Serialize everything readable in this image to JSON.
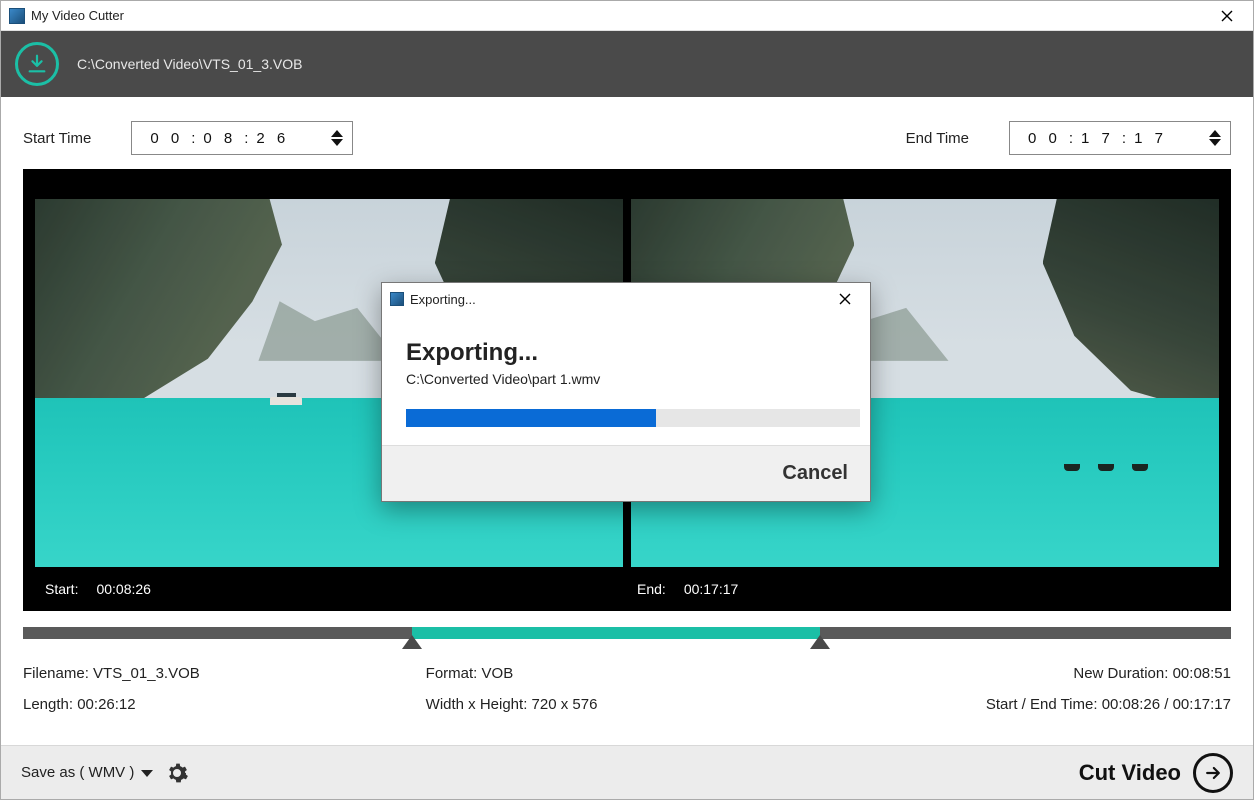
{
  "window": {
    "title": "My Video Cutter"
  },
  "header": {
    "filepath": "C:\\Converted Video\\VTS_01_3.VOB"
  },
  "time": {
    "start_label": "Start Time",
    "end_label": "End Time",
    "start": {
      "hh": "0 0",
      "mm": "0 8",
      "ss": "2 6"
    },
    "end": {
      "hh": "0 0",
      "mm": "1 7",
      "ss": "1 7"
    }
  },
  "preview": {
    "start_label": "Start:",
    "start_value": "00:08:26",
    "end_label": "End:",
    "end_value": "00:17:17"
  },
  "trim": {
    "sel_start_pct": 32.2,
    "sel_end_pct": 66.0
  },
  "info": {
    "filename_label": "Filename:",
    "filename": "VTS_01_3.VOB",
    "format_label": "Format:",
    "format": "VOB",
    "newdur_label": "New Duration:",
    "newdur": "00:08:51",
    "length_label": "Length:",
    "length": "00:26:12",
    "wh_label": "Width x Height:",
    "wh": "720 x 576",
    "setime_label": "Start / End Time:",
    "setime": "00:08:26 / 00:17:17"
  },
  "footer": {
    "saveas_prefix": "Save as ( ",
    "saveas_format": "WMV",
    "saveas_suffix": " )",
    "cut_label": "Cut Video"
  },
  "dialog": {
    "title": "Exporting...",
    "heading": "Exporting...",
    "path": "C:\\Converted Video\\part 1.wmv",
    "progress_pct": 55,
    "cancel": "Cancel"
  }
}
